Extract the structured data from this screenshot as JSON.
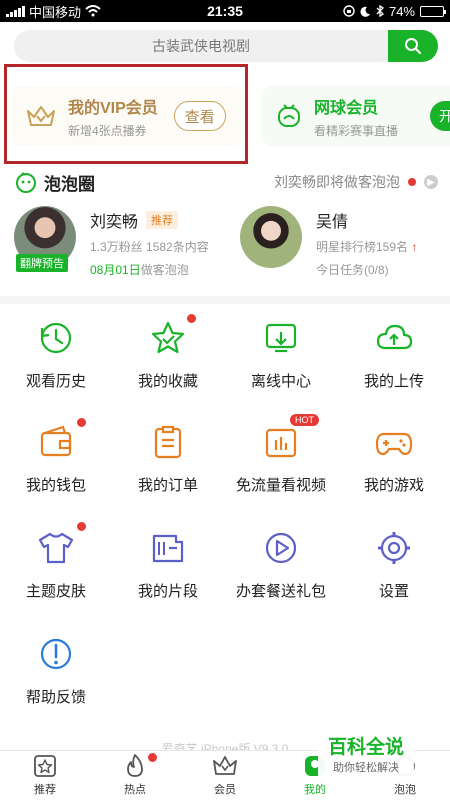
{
  "status_bar": {
    "carrier": "中国移动",
    "time": "21:35",
    "battery": "74%",
    "battery_fill": 0.74
  },
  "search": {
    "placeholder": "古装武侠电视剧"
  },
  "vip_card": {
    "title": "我的VIP会员",
    "subtitle": "新增4张点播券",
    "button": "查看"
  },
  "tennis_card": {
    "title": "网球会员",
    "subtitle": "看精彩赛事直播",
    "button": "开"
  },
  "bubble": {
    "title": "泡泡圈",
    "notice": "刘奕畅即将做客泡泡",
    "stars": [
      {
        "name": "刘奕畅",
        "tag": "推荐",
        "meta": "1.3万粉丝 1582条内容",
        "date": "08月01日",
        "date_suffix": "做客泡泡",
        "badge": "翻牌预告"
      },
      {
        "name": "吴倩",
        "meta": "明星排行榜159名",
        "task": "今日任务(0/8)"
      }
    ]
  },
  "grid": [
    {
      "label": "观看历史",
      "icon": "history-icon"
    },
    {
      "label": "我的收藏",
      "icon": "favorite-star-icon"
    },
    {
      "label": "离线中心",
      "icon": "offline-download-icon"
    },
    {
      "label": "我的上传",
      "icon": "upload-cloud-icon"
    },
    {
      "label": "我的钱包",
      "icon": "wallet-icon"
    },
    {
      "label": "我的订单",
      "icon": "order-icon"
    },
    {
      "label": "免流量看视频",
      "icon": "free-data-icon",
      "badge": "HOT"
    },
    {
      "label": "我的游戏",
      "icon": "gamepad-icon"
    },
    {
      "label": "主题皮肤",
      "icon": "tshirt-icon"
    },
    {
      "label": "我的片段",
      "icon": "film-clip-icon"
    },
    {
      "label": "办套餐送礼包",
      "icon": "play-circle-icon"
    },
    {
      "label": "设置",
      "icon": "settings-gear-icon"
    },
    {
      "label": "帮助反馈",
      "icon": "help-icon"
    }
  ],
  "version": "爱奇艺 iPhone版 V9.3.0",
  "watermark": {
    "title": "百科全说",
    "subtitle": "助你轻松解决"
  },
  "tabs": [
    {
      "label": "推荐"
    },
    {
      "label": "热点"
    },
    {
      "label": "会员"
    },
    {
      "label": "我的"
    },
    {
      "label": "泡泡"
    }
  ],
  "colors": {
    "green": "#19b32a",
    "orange": "#e67e22",
    "red": "#e53935",
    "gold": "#b0874a",
    "purple": "#5b5fc7",
    "blue": "#2b7bd6",
    "highlight": "#b3262a"
  }
}
